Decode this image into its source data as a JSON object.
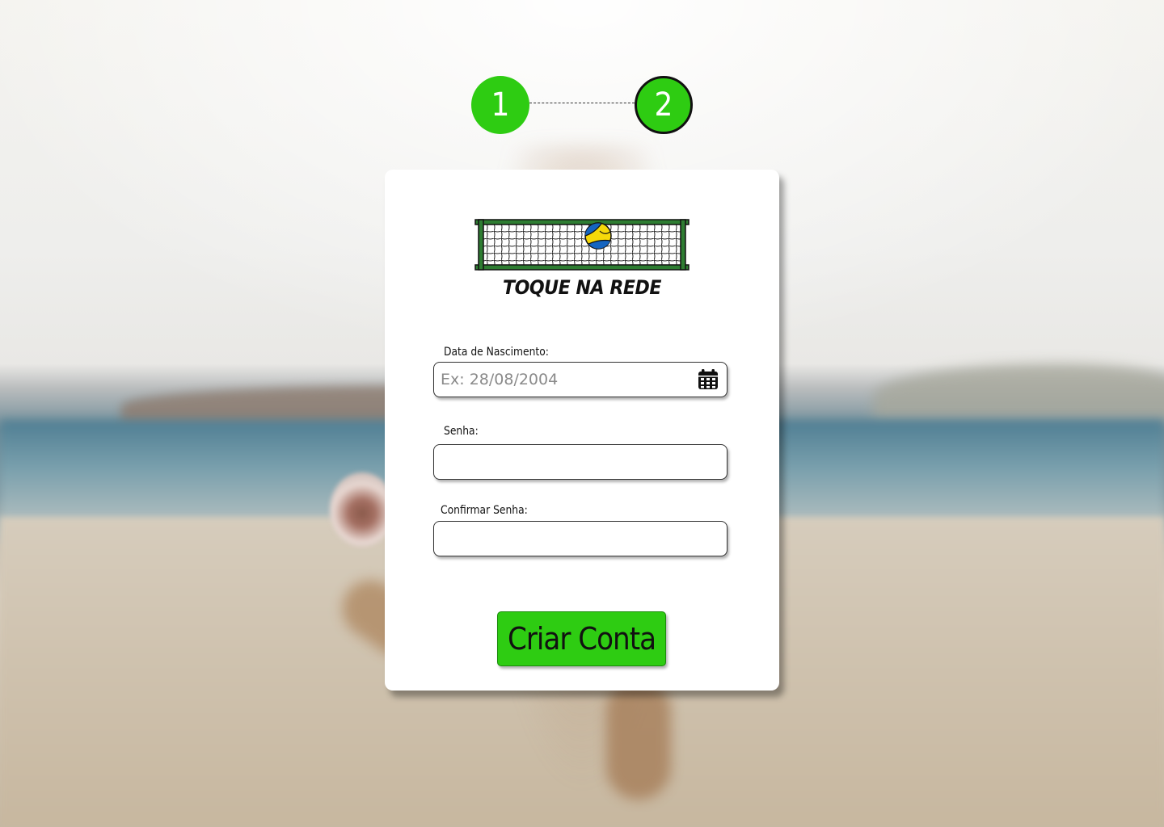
{
  "stepper": {
    "steps": [
      "1",
      "2"
    ],
    "active_step": 2
  },
  "brand": {
    "name": "TOQUE NA REDE"
  },
  "form": {
    "birthdate": {
      "label": "Data de Nascimento:",
      "placeholder": "Ex: 28/08/2004",
      "value": ""
    },
    "password": {
      "label": "Senha:",
      "value": ""
    },
    "confirm_password": {
      "label": "Confirmar Senha:",
      "value": ""
    },
    "submit_label": "Criar Conta"
  },
  "icons": {
    "birthdate": "calendar-icon"
  },
  "colors": {
    "accent": "#2ecc12",
    "net_frame": "#2e7d32",
    "ball_blue": "#1565c0",
    "ball_yellow": "#f5d90a",
    "card": "#ffffff"
  }
}
